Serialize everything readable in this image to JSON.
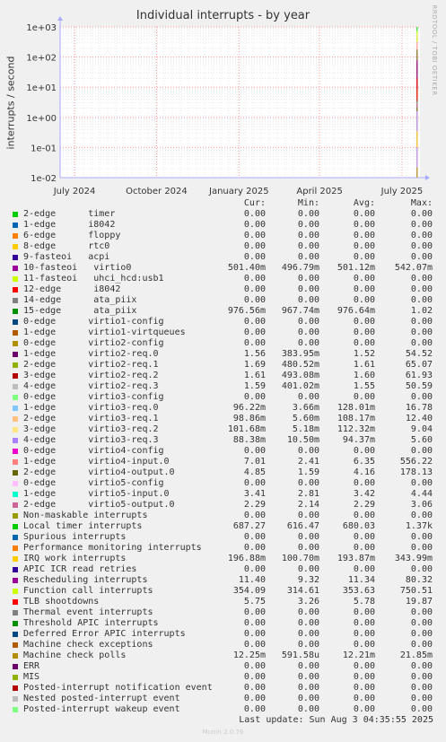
{
  "chart_data": {
    "type": "line",
    "title": "Individual interrupts - by year",
    "ylabel": "interrupts / second",
    "yscale": "log",
    "ylim": [
      0.01,
      1000
    ],
    "yticks": [
      "1e-02",
      "1e-01",
      "1e+00",
      "1e+01",
      "1e+02",
      "1e+03"
    ],
    "xticks": [
      "July 2024",
      "October 2024",
      "January 2025",
      "April 2025",
      "July 2025"
    ],
    "grid": true,
    "legend_columns": [
      "Cur:",
      "Min:",
      "Avg:",
      "Max:"
    ],
    "series": [
      {
        "name": "2-edge      timer",
        "color": "#00cc00",
        "cur": "0.00",
        "min": "0.00",
        "avg": "0.00",
        "max": "0.00"
      },
      {
        "name": "1-edge      i8042",
        "color": "#0066b3",
        "cur": "0.00",
        "min": "0.00",
        "avg": "0.00",
        "max": "0.00"
      },
      {
        "name": "6-edge      floppy",
        "color": "#ff8000",
        "cur": "0.00",
        "min": "0.00",
        "avg": "0.00",
        "max": "0.00"
      },
      {
        "name": "8-edge      rtc0",
        "color": "#ffcc00",
        "cur": "0.00",
        "min": "0.00",
        "avg": "0.00",
        "max": "0.00"
      },
      {
        "name": "9-fasteoi   acpi",
        "color": "#330099",
        "cur": "0.00",
        "min": "0.00",
        "avg": "0.00",
        "max": "0.00"
      },
      {
        "name": "10-fasteoi   virtio0",
        "color": "#990099",
        "cur": "501.40m",
        "min": "496.79m",
        "avg": "501.12m",
        "max": "542.07m"
      },
      {
        "name": "11-fasteoi   uhci_hcd:usb1",
        "color": "#ccff00",
        "cur": "0.00",
        "min": "0.00",
        "avg": "0.00",
        "max": "0.00"
      },
      {
        "name": "12-edge      i8042",
        "color": "#ff0000",
        "cur": "0.00",
        "min": "0.00",
        "avg": "0.00",
        "max": "0.00"
      },
      {
        "name": "14-edge      ata_piix",
        "color": "#808080",
        "cur": "0.00",
        "min": "0.00",
        "avg": "0.00",
        "max": "0.00"
      },
      {
        "name": "15-edge      ata_piix",
        "color": "#008f00",
        "cur": "976.56m",
        "min": "967.74m",
        "avg": "976.64m",
        "max": "1.02"
      },
      {
        "name": "0-edge      virtio1-config",
        "color": "#00487d",
        "cur": "0.00",
        "min": "0.00",
        "avg": "0.00",
        "max": "0.00"
      },
      {
        "name": "1-edge      virtio1-virtqueues",
        "color": "#b35a00",
        "cur": "0.00",
        "min": "0.00",
        "avg": "0.00",
        "max": "0.00"
      },
      {
        "name": "0-edge      virtio2-config",
        "color": "#b38f00",
        "cur": "0.00",
        "min": "0.00",
        "avg": "0.00",
        "max": "0.00"
      },
      {
        "name": "1-edge      virtio2-req.0",
        "color": "#6b006b",
        "cur": "1.56",
        "min": "383.95m",
        "avg": "1.52",
        "max": "54.52"
      },
      {
        "name": "2-edge      virtio2-req.1",
        "color": "#8fb300",
        "cur": "1.69",
        "min": "480.52m",
        "avg": "1.61",
        "max": "65.07"
      },
      {
        "name": "3-edge      virtio2-req.2",
        "color": "#b30000",
        "cur": "1.61",
        "min": "493.08m",
        "avg": "1.60",
        "max": "61.93"
      },
      {
        "name": "4-edge      virtio2-req.3",
        "color": "#bebebe",
        "cur": "1.59",
        "min": "401.02m",
        "avg": "1.55",
        "max": "50.59"
      },
      {
        "name": "0-edge      virtio3-config",
        "color": "#80ff80",
        "cur": "0.00",
        "min": "0.00",
        "avg": "0.00",
        "max": "0.00"
      },
      {
        "name": "1-edge      virtio3-req.0",
        "color": "#80c9ff",
        "cur": "96.22m",
        "min": "3.66m",
        "avg": "128.01m",
        "max": "16.78"
      },
      {
        "name": "2-edge      virtio3-req.1",
        "color": "#ffc080",
        "cur": "98.86m",
        "min": "5.60m",
        "avg": "108.17m",
        "max": "12.40"
      },
      {
        "name": "3-edge      virtio3-req.2",
        "color": "#ffe680",
        "cur": "101.68m",
        "min": "5.18m",
        "avg": "112.32m",
        "max": "9.04"
      },
      {
        "name": "4-edge      virtio3-req.3",
        "color": "#aa80ff",
        "cur": "88.38m",
        "min": "10.50m",
        "avg": "94.37m",
        "max": "5.60"
      },
      {
        "name": "0-edge      virtio4-config",
        "color": "#ee00cc",
        "cur": "0.00",
        "min": "0.00",
        "avg": "0.00",
        "max": "0.00"
      },
      {
        "name": "1-edge      virtio4-input.0",
        "color": "#ff8080",
        "cur": "7.01",
        "min": "2.41",
        "avg": "6.35",
        "max": "556.22"
      },
      {
        "name": "2-edge      virtio4-output.0",
        "color": "#666600",
        "cur": "4.85",
        "min": "1.59",
        "avg": "4.16",
        "max": "178.13"
      },
      {
        "name": "0-edge      virtio5-config",
        "color": "#ffbfff",
        "cur": "0.00",
        "min": "0.00",
        "avg": "0.00",
        "max": "0.00"
      },
      {
        "name": "1-edge      virtio5-input.0",
        "color": "#00ffcc",
        "cur": "3.41",
        "min": "2.81",
        "avg": "3.42",
        "max": "4.44"
      },
      {
        "name": "2-edge      virtio5-output.0",
        "color": "#cc6699",
        "cur": "2.29",
        "min": "2.14",
        "avg": "2.29",
        "max": "3.06"
      },
      {
        "name": "Non-maskable interrupts",
        "color": "#999900",
        "cur": "0.00",
        "min": "0.00",
        "avg": "0.00",
        "max": "0.00"
      },
      {
        "name": "Local timer interrupts",
        "color": "#00cc00",
        "cur": "687.27",
        "min": "616.47",
        "avg": "680.03",
        "max": "1.37k"
      },
      {
        "name": "Spurious interrupts",
        "color": "#0066b3",
        "cur": "0.00",
        "min": "0.00",
        "avg": "0.00",
        "max": "0.00"
      },
      {
        "name": "Performance monitoring interrupts",
        "color": "#ff8000",
        "cur": "0.00",
        "min": "0.00",
        "avg": "0.00",
        "max": "0.00"
      },
      {
        "name": "IRQ work interrupts",
        "color": "#ffcc00",
        "cur": "196.88m",
        "min": "100.70m",
        "avg": "193.87m",
        "max": "343.99m"
      },
      {
        "name": "APIC ICR read retries",
        "color": "#330099",
        "cur": "0.00",
        "min": "0.00",
        "avg": "0.00",
        "max": "0.00"
      },
      {
        "name": "Rescheduling interrupts",
        "color": "#990099",
        "cur": "11.40",
        "min": "9.32",
        "avg": "11.34",
        "max": "80.32"
      },
      {
        "name": "Function call interrupts",
        "color": "#ccff00",
        "cur": "354.09",
        "min": "314.61",
        "avg": "353.63",
        "max": "750.51"
      },
      {
        "name": "TLB shootdowns",
        "color": "#ff0000",
        "cur": "5.75",
        "min": "3.26",
        "avg": "5.78",
        "max": "19.87"
      },
      {
        "name": "Thermal event interrupts",
        "color": "#808080",
        "cur": "0.00",
        "min": "0.00",
        "avg": "0.00",
        "max": "0.00"
      },
      {
        "name": "Threshold APIC interrupts",
        "color": "#008f00",
        "cur": "0.00",
        "min": "0.00",
        "avg": "0.00",
        "max": "0.00"
      },
      {
        "name": "Deferred Error APIC interrupts",
        "color": "#00487d",
        "cur": "0.00",
        "min": "0.00",
        "avg": "0.00",
        "max": "0.00"
      },
      {
        "name": "Machine check exceptions",
        "color": "#b35a00",
        "cur": "0.00",
        "min": "0.00",
        "avg": "0.00",
        "max": "0.00"
      },
      {
        "name": "Machine check polls",
        "color": "#b38f00",
        "cur": "12.25m",
        "min": "591.58u",
        "avg": "12.21m",
        "max": "21.85m"
      },
      {
        "name": "ERR",
        "color": "#6b006b",
        "cur": "0.00",
        "min": "0.00",
        "avg": "0.00",
        "max": "0.00"
      },
      {
        "name": "MIS",
        "color": "#8fb300",
        "cur": "0.00",
        "min": "0.00",
        "avg": "0.00",
        "max": "0.00"
      },
      {
        "name": "Posted-interrupt notification event",
        "color": "#b30000",
        "cur": "0.00",
        "min": "0.00",
        "avg": "0.00",
        "max": "0.00"
      },
      {
        "name": "Nested posted-interrupt event",
        "color": "#bebebe",
        "cur": "0.00",
        "min": "0.00",
        "avg": "0.00",
        "max": "0.00"
      },
      {
        "name": "Posted-interrupt wakeup event",
        "color": "#80ff80",
        "cur": "0.00",
        "min": "0.00",
        "avg": "0.00",
        "max": "0.00"
      }
    ]
  },
  "footer": {
    "last_update": "Last update: Sun Aug  3 04:35:55 2025",
    "generator": "Munin 2.0.76"
  },
  "side_text": "RRDTOOL / TOBI OETIKER"
}
